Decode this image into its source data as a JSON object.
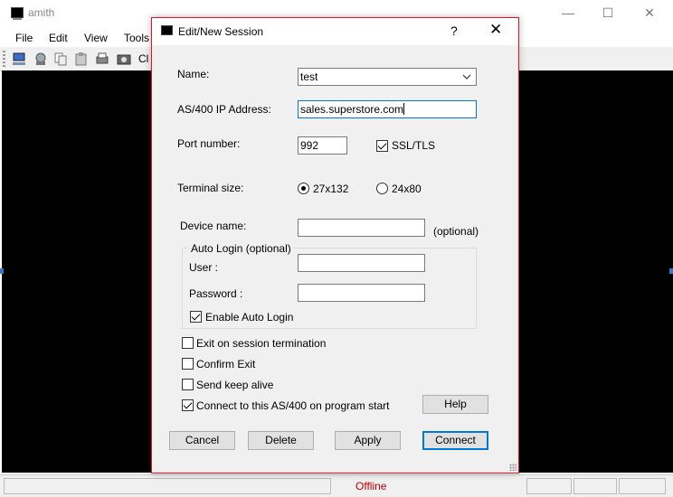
{
  "main_window": {
    "title": "amith",
    "controls": {
      "minimize": "—",
      "maximize": "☐",
      "close": "✕"
    },
    "menu": [
      "File",
      "Edit",
      "View",
      "Tools"
    ],
    "toolbar_partial_label": "Cl",
    "status": {
      "connection": "Offline"
    }
  },
  "dialog": {
    "title": "Edit/New Session",
    "help_glyph": "?",
    "close_glyph": "✕",
    "name": {
      "label": "Name:",
      "value": "test"
    },
    "ip": {
      "label": "AS/400 IP Address:",
      "value": "sales.superstore.com"
    },
    "port": {
      "label": "Port number:",
      "value": "992"
    },
    "ssl": {
      "label": "SSL/TLS",
      "checked": true
    },
    "terminal": {
      "label": "Terminal size:",
      "options": [
        {
          "label": "27x132",
          "selected": true
        },
        {
          "label": "24x80",
          "selected": false
        }
      ]
    },
    "device": {
      "label": "Device name:",
      "value": "",
      "hint": "(optional)"
    },
    "auto_login": {
      "legend": "Auto Login (optional)",
      "user_label": "User :",
      "user_value": "",
      "password_label": "Password :",
      "password_value": "",
      "enable_label": "Enable Auto Login",
      "enable_checked": true
    },
    "options": [
      {
        "label": "Exit on session termination",
        "checked": false
      },
      {
        "label": "Confirm Exit",
        "checked": false
      },
      {
        "label": "Send keep alive",
        "checked": false
      },
      {
        "label": "Connect to this AS/400 on program start",
        "checked": true
      }
    ],
    "buttons": {
      "help": "Help",
      "cancel": "Cancel",
      "delete": "Delete",
      "apply": "Apply",
      "connect": "Connect"
    }
  },
  "colors": {
    "dialog_border": "#e81123",
    "focus_blue": "#0078d7",
    "offline_red": "#c00000"
  }
}
